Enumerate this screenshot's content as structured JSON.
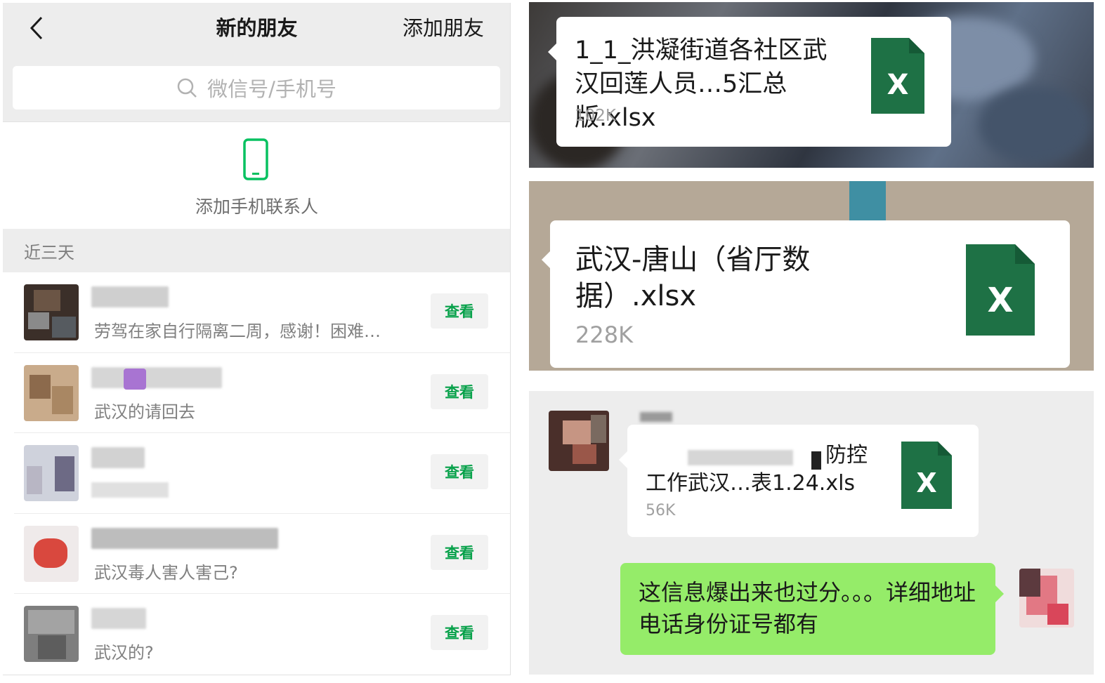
{
  "new_friends": {
    "title": "新的朋友",
    "add_friend": "添加朋友",
    "search_placeholder": "微信号/手机号",
    "add_phone_contacts": "添加手机联系人",
    "section_label": "近三天",
    "view_label": "查看",
    "friends": [
      {
        "message": "劳驾在家自行隔离二周，感谢！困难…"
      },
      {
        "message": "武汉的请回去"
      },
      {
        "message": ""
      },
      {
        "message": "武汉毒人害人害己?"
      },
      {
        "message": "武汉的?"
      }
    ]
  },
  "file_messages": [
    {
      "name": "1_1_洪凝街道各社区武汉回莲人员…5汇总版.xlsx",
      "size": "102K",
      "icon": "excel-file-icon"
    },
    {
      "name": "武汉-唐山（省厅数据）.xlsx",
      "size": "228K",
      "icon": "excel-file-icon"
    },
    {
      "name": "工作武汉…表1.24.xls",
      "name_fragment": "防控",
      "size": "56K",
      "icon": "excel-file-icon"
    }
  ],
  "chat_message": {
    "text": "这信息爆出来也过分。。。详细地址电话身份证号都有"
  },
  "colors": {
    "wechat_green": "#07a14a",
    "bubble_green": "#95ec69",
    "excel_green": "#1e7145",
    "background_gray": "#ededed"
  }
}
